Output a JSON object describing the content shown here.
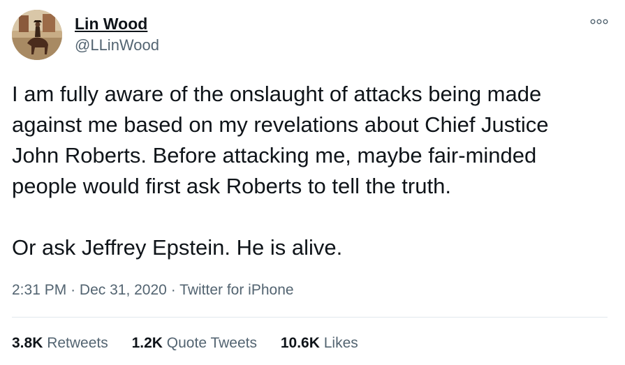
{
  "author": {
    "name": "Lin Wood",
    "handle": "@LLinWood"
  },
  "icons": {
    "more": "more-options-icon",
    "avatar": "profile-photo-horse-rider"
  },
  "tweet": {
    "lines": [
      "I am fully aware of the onslaught of attacks being made",
      "against me based on my revelations about Chief Justice",
      "John Roberts. Before attacking me, maybe fair-minded",
      "people would first ask Roberts to tell the truth."
    ],
    "second_paragraph": "Or ask Jeffrey Epstein. He is alive."
  },
  "meta": {
    "time": "2:31 PM",
    "separator": "·",
    "date": "Dec 31, 2020",
    "source": "Twitter for iPhone"
  },
  "stats": {
    "retweets": {
      "count": "3.8K",
      "label": "Retweets"
    },
    "quote_tweets": {
      "count": "1.2K",
      "label": "Quote Tweets"
    },
    "likes": {
      "count": "10.6K",
      "label": "Likes"
    }
  },
  "colors": {
    "text": "#0f1419",
    "secondary": "#536471",
    "divider": "#e1e8ed"
  }
}
